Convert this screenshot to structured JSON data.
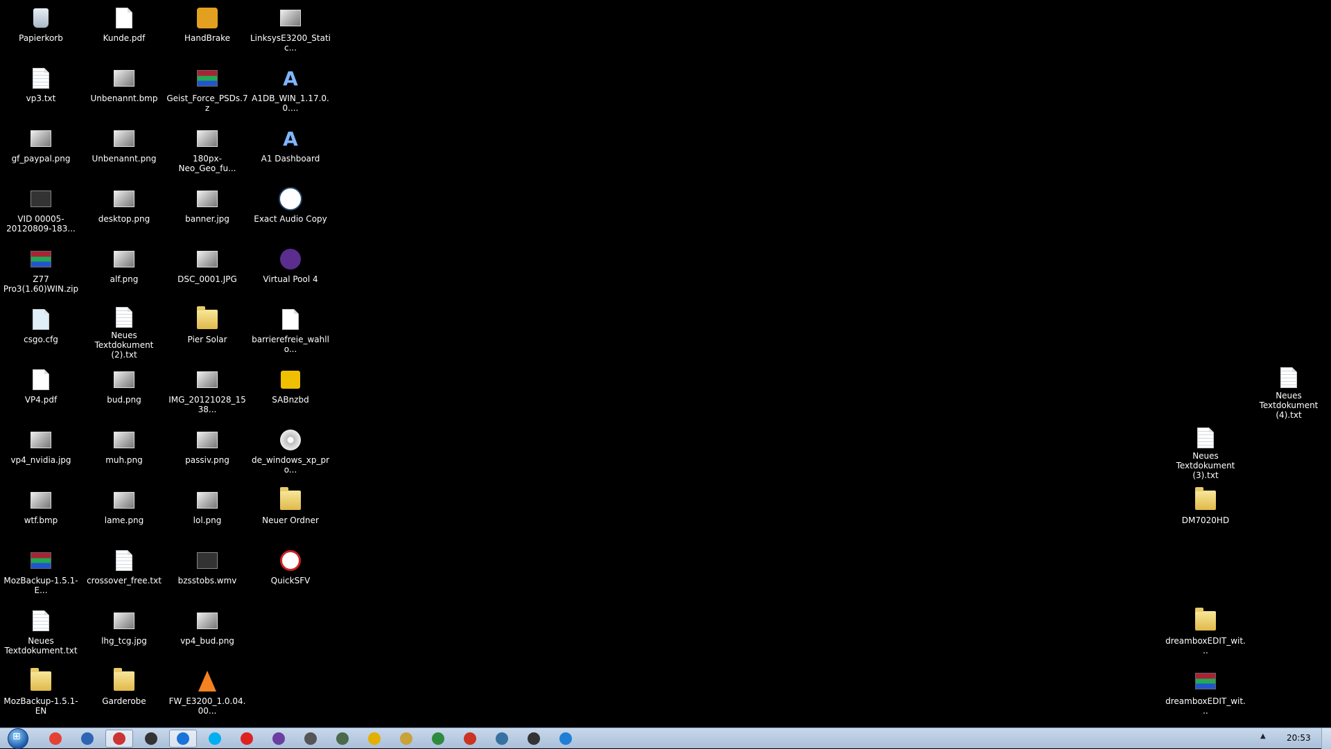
{
  "desktop": {
    "icons": [
      {
        "label": "Papierkorb",
        "icon": "recycle-bin-icon"
      },
      {
        "label": "vp3.txt",
        "icon": "text-file-icon"
      },
      {
        "label": "gf_paypal.png",
        "icon": "image-file-icon"
      },
      {
        "label": "VID 00005-20120809-183...",
        "icon": "video-file-icon"
      },
      {
        "label": "Z77 Pro3(1.60)WIN.zip",
        "icon": "winrar-archive-icon"
      },
      {
        "label": "csgo.cfg",
        "icon": "config-file-icon"
      },
      {
        "label": "VP4.pdf",
        "icon": "pdf-file-icon"
      },
      {
        "label": "vp4_nvidia.jpg",
        "icon": "image-file-icon"
      },
      {
        "label": "wtf.bmp",
        "icon": "image-file-icon"
      },
      {
        "label": "MozBackup-1.5.1-E...",
        "icon": "winrar-archive-icon"
      },
      {
        "label": "Neues Textdokument.txt",
        "icon": "text-file-icon"
      },
      {
        "label": "MozBackup-1.5.1-EN",
        "icon": "folder-icon"
      },
      {
        "label": "Kunde.pdf",
        "icon": "pdf-file-icon"
      },
      {
        "label": "Unbenannt.bmp",
        "icon": "image-file-icon"
      },
      {
        "label": "Unbenannt.png",
        "icon": "image-file-icon"
      },
      {
        "label": "desktop.png",
        "icon": "image-file-icon"
      },
      {
        "label": "alf.png",
        "icon": "image-file-icon"
      },
      {
        "label": "Neues Textdokument (2).txt",
        "icon": "text-file-icon"
      },
      {
        "label": "bud.png",
        "icon": "image-file-icon"
      },
      {
        "label": "muh.png",
        "icon": "image-file-icon"
      },
      {
        "label": "lame.png",
        "icon": "image-file-icon"
      },
      {
        "label": "crossover_free.txt",
        "icon": "text-file-icon"
      },
      {
        "label": "lhg_tcg.jpg",
        "icon": "image-file-icon"
      },
      {
        "label": "Garderobe",
        "icon": "folder-icon"
      },
      {
        "label": "HandBrake",
        "icon": "handbrake-icon"
      },
      {
        "label": "Geist_Force_PSDs.7z",
        "icon": "winrar-archive-icon"
      },
      {
        "label": "180px-Neo_Geo_fu...",
        "icon": "image-file-icon"
      },
      {
        "label": "banner.jpg",
        "icon": "image-file-icon"
      },
      {
        "label": "DSC_0001.JPG",
        "icon": "image-file-icon"
      },
      {
        "label": "Pier Solar",
        "icon": "folder-icon"
      },
      {
        "label": "IMG_20121028_1538...",
        "icon": "image-file-icon"
      },
      {
        "label": "passiv.png",
        "icon": "image-file-icon"
      },
      {
        "label": "lol.png",
        "icon": "image-file-icon"
      },
      {
        "label": "bzsstobs.wmv",
        "icon": "video-file-icon"
      },
      {
        "label": "vp4_bud.png",
        "icon": "image-file-icon"
      },
      {
        "label": "FW_E3200_1.0.04.00...",
        "icon": "vlc-icon"
      },
      {
        "label": "LinksysE3200_Static...",
        "icon": "image-file-icon"
      },
      {
        "label": "A1DB_WIN_1.17.0.0....",
        "icon": "a1-installer-icon"
      },
      {
        "label": "A1 Dashboard",
        "icon": "a1-dashboard-icon"
      },
      {
        "label": "Exact Audio Copy",
        "icon": "eac-icon"
      },
      {
        "label": "Virtual Pool 4",
        "icon": "virtual-pool-icon"
      },
      {
        "label": "barrierefreie_wahllo...",
        "icon": "blank-file-icon"
      },
      {
        "label": "SABnzbd",
        "icon": "sabnzbd-icon"
      },
      {
        "label": "de_windows_xp_pro...",
        "icon": "disc-image-icon"
      },
      {
        "label": "Neuer Ordner",
        "icon": "folder-icon"
      },
      {
        "label": "QuickSFV",
        "icon": "quicksfv-icon"
      },
      {
        "label": "Neues Textdokument (4).txt",
        "icon": "text-file-icon"
      },
      {
        "label": "Neues Textdokument (3).txt",
        "icon": "text-file-icon"
      },
      {
        "label": "DM7020HD",
        "icon": "folder-icon"
      },
      {
        "label": "dreamboxEDIT_wit...",
        "icon": "folder-icon"
      },
      {
        "label": "dreamboxEDIT_wit...",
        "icon": "winrar-archive-icon"
      }
    ]
  },
  "taskbar": {
    "start_icon": "windows-start-orb-icon",
    "buttons": [
      {
        "icon": "chrome-icon",
        "color": "#e44134"
      },
      {
        "icon": "thunderbird-icon",
        "color": "#2f63b4"
      },
      {
        "icon": "app-icon",
        "color": "#c33"
      },
      {
        "icon": "steam-icon",
        "color": "#333"
      },
      {
        "icon": "teamviewer-icon",
        "color": "#1a73d9"
      },
      {
        "icon": "skype-icon",
        "color": "#00aff0"
      },
      {
        "icon": "uplay-icon",
        "color": "#d22"
      },
      {
        "icon": "purple-app-icon",
        "color": "#6b3fa0"
      },
      {
        "icon": "alien-icon",
        "color": "#555"
      },
      {
        "icon": "controller-icon",
        "color": "#4a6a4a"
      },
      {
        "icon": "sabnzbd-icon",
        "color": "#e1b000"
      },
      {
        "icon": "network-icon",
        "color": "#c9a23b"
      },
      {
        "icon": "utorrent-icon",
        "color": "#2e8b3d"
      },
      {
        "icon": "filezilla-icon",
        "color": "#c32"
      },
      {
        "icon": "python-icon",
        "color": "#3771a1"
      },
      {
        "icon": "shield-icon",
        "color": "#333"
      },
      {
        "icon": "display-icon",
        "color": "#1f7fd6"
      }
    ],
    "clock": "20:53",
    "tray_arrow": "▲"
  }
}
